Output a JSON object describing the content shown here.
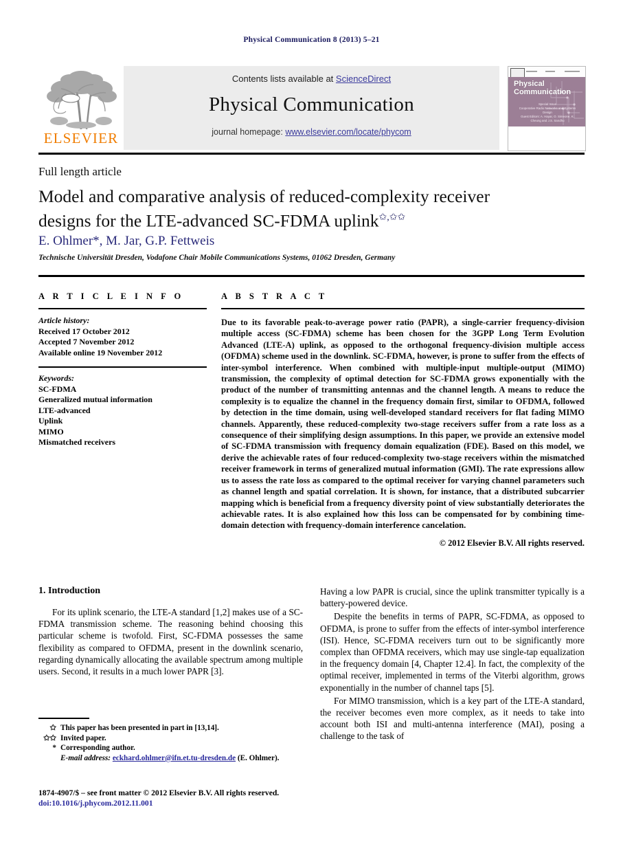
{
  "running_head": "Physical Communication 8 (2013) 5–21",
  "masthead": {
    "contents_prefix": "Contents lists available at ",
    "sciencedirect": "ScienceDirect",
    "journal_title": "Physical Communication",
    "homepage_prefix": "journal homepage: ",
    "homepage_url": "www.elsevier.com/locate/phycom",
    "publisher_wordmark": "ELSEVIER",
    "publisher_logo_icon": "elsevier-tree-logo",
    "cover_title": "Physical Communication",
    "cover_caption_1": "Special Issue",
    "cover_caption_2": "Cooperative Radio Networks and Systems Design",
    "cover_caption_3": "Guest Editors: A. Hayar, O. Simeone, K. Cheung and J.S. Sandhu",
    "accent_orange": "#f07d00",
    "link_blue": "#3a3a9c",
    "band_gray": "#ececec",
    "cover_mauve": "#9c7f96"
  },
  "article": {
    "type_label": "Full length article",
    "title": "Model and comparative analysis of reduced-complexity receiver designs for the LTE-advanced SC-FDMA uplink",
    "title_footnote_marks": "✩,✩✩",
    "authors": "E. Ohlmer*, M. Jar, G.P. Fettweis",
    "affiliation": "Technische Universität Dresden, Vodafone Chair Mobile Communications Systems, 01062 Dresden, Germany",
    "title_color": "#111111",
    "author_color": "#2a2a7a"
  },
  "article_info": {
    "heading": "A R T I C L E   I N F O",
    "history_label": "Article history:",
    "history": [
      "Received 17 October 2012",
      "Accepted 7 November 2012",
      "Available online 19 November 2012"
    ],
    "keywords_label": "Keywords:",
    "keywords": [
      "SC-FDMA",
      "Generalized mutual information",
      "LTE-advanced",
      "Uplink",
      "MIMO",
      "Mismatched receivers"
    ]
  },
  "abstract": {
    "heading": "A B S T R A C T",
    "text": "Due to its favorable peak-to-average power ratio (PAPR), a single-carrier frequency-division multiple access (SC-FDMA) scheme has been chosen for the 3GPP Long Term Evolution Advanced (LTE-A) uplink, as opposed to the orthogonal frequency-division multiple access (OFDMA) scheme used in the downlink. SC-FDMA, however, is prone to suffer from the effects of inter-symbol interference. When combined with multiple-input multiple-output (MIMO) transmission, the complexity of optimal detection for SC-FDMA grows exponentially with the product of the number of transmitting antennas and the channel length. A means to reduce the complexity is to equalize the channel in the frequency domain first, similar to OFDMA, followed by detection in the time domain, using well-developed standard receivers for flat fading MIMO channels. Apparently, these reduced-complexity two-stage receivers suffer from a rate loss as a consequence of their simplifying design assumptions. In this paper, we provide an extensive model of SC-FDMA transmission with frequency domain equalization (FDE). Based on this model, we derive the achievable rates of four reduced-complexity two-stage receivers within the mismatched receiver framework in terms of generalized mutual information (GMI). The rate expressions allow us to assess the rate loss as compared to the optimal receiver for varying channel parameters such as channel length and spatial correlation. It is shown, for instance, that a distributed subcarrier mapping which is beneficial from a frequency diversity point of view substantially deteriorates the achievable rates. It is also explained how this loss can be compensated for by combining time-domain detection with frequency-domain interference cancelation.",
    "copyright": "© 2012 Elsevier B.V. All rights reserved."
  },
  "body": {
    "section_number_title": "1.  Introduction",
    "left_paragraph_1": "For its uplink scenario, the LTE-A standard [1,2] makes use of a SC-FDMA transmission scheme. The reasoning behind choosing this particular scheme is twofold. First, SC-FDMA possesses the same flexibility as compared to OFDMA, present in the downlink scenario, regarding dynamically allocating the available spectrum among multiple users. Second, it results in a much lower PAPR [3].",
    "right_paragraph_1": "Having a low PAPR is crucial, since the uplink transmitter typically is a battery-powered device.",
    "right_paragraph_2": "Despite the benefits in terms of PAPR, SC-FDMA, as opposed to OFDMA, is prone to suffer from the effects of inter-symbol interference (ISI). Hence, SC-FDMA receivers turn out to be significantly more complex than OFDMA receivers, which may use single-tap equalization in the frequency domain [4, Chapter 12.4]. In fact, the complexity of the optimal receiver, implemented in terms of the Viterbi algorithm, grows exponentially in the number of channel taps [5].",
    "right_paragraph_3": "For MIMO transmission, which is a key part of the LTE-A standard, the receiver becomes even more complex, as it needs to take into account both ISI and multi-antenna interference (MAI), posing a challenge to the task of"
  },
  "footnotes": [
    {
      "mark": "✩",
      "text": "This paper has been presented in part in [13,14]."
    },
    {
      "mark": "✩✩",
      "text": "Invited paper."
    },
    {
      "mark": "*",
      "text": "Corresponding author."
    }
  ],
  "email_note": {
    "label": "E-mail address:",
    "address": "eckhard.ohlmer@ifn.et.tu-dresden.de",
    "owner": "(E. Ohlmer)."
  },
  "imprint": {
    "issn_line": "1874-4907/$ – see front matter © 2012 Elsevier B.V. All rights reserved.",
    "doi_line": "doi:10.1016/j.phycom.2012.11.001"
  }
}
